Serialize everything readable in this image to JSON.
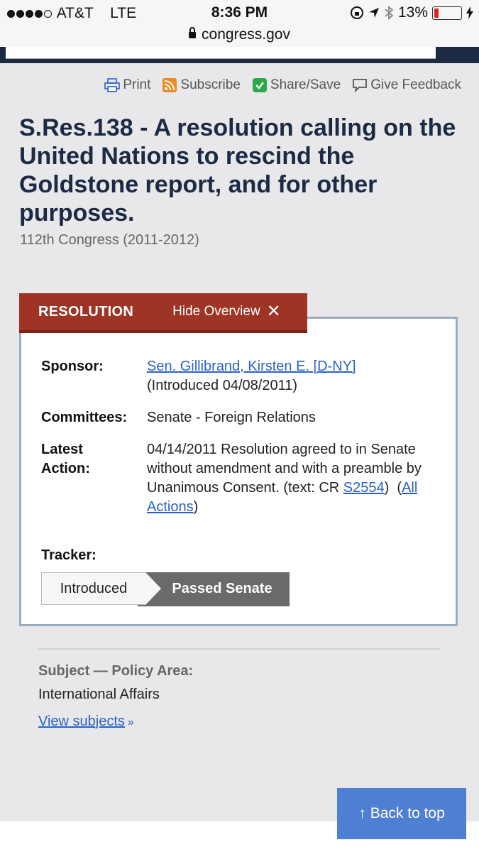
{
  "status": {
    "carrier": "AT&T",
    "network": "LTE",
    "time": "8:36 PM",
    "battery": "13%",
    "url": "congress.gov"
  },
  "tools": [
    {
      "label": "Print",
      "icon": "printer-icon"
    },
    {
      "label": "Subscribe",
      "icon": "rss-icon"
    },
    {
      "label": "Share/Save",
      "icon": "share-icon"
    },
    {
      "label": "Give Feedback",
      "icon": "speech-bubble-icon"
    }
  ],
  "title": "S.Res.138 - A resolution calling on the United Nations to rescind the Goldstone report, and for other purposes.",
  "congress": "112th Congress (2011-2012)",
  "overview": {
    "tab_title": "RESOLUTION",
    "hide_label": "Hide Overview",
    "close_glyph": "✕",
    "sponsor_label": "Sponsor:",
    "sponsor_link": "Sen. Gillibrand, Kirsten E. [D-NY]",
    "sponsor_intro": "(Introduced 04/08/2011)",
    "committees_label": "Committees:",
    "committees_value": "Senate - Foreign Relations",
    "latest_label_1": "Latest",
    "latest_label_2": "Action:",
    "latest_text": "04/14/2011 Resolution agreed to in Senate without amendment and with a preamble by Unanimous Consent. (text: CR ",
    "latest_link": "S2554",
    "latest_mid": ")  (",
    "latest_all": "All Actions",
    "latest_end": ")",
    "tracker_label": "Tracker:",
    "tracker_steps": [
      "Introduced",
      "Passed Senate"
    ]
  },
  "subject": {
    "heading": "Subject — Policy Area:",
    "value": "International Affairs",
    "link": "View subjects",
    "link_glyph": "»"
  },
  "back_to_top": "Back to top",
  "back_to_top_glyph": "↑",
  "colors": {
    "navy": "#1c2a44",
    "resolution_red": "#9e3426",
    "link_blue": "#2a62c4",
    "button_blue": "#4f7fd2"
  }
}
